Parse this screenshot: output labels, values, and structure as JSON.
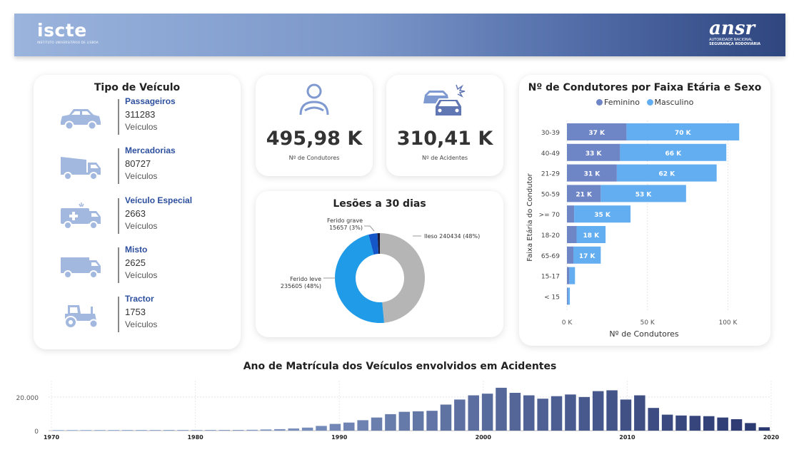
{
  "header": {
    "left_logo": "iscte",
    "left_logo_sub": "INSTITUTO UNIVERSITÁRIO DE LISBOA",
    "right_logo": "ansr",
    "right_logo_sub1": "AUTORIDADE NACIONAL",
    "right_logo_sub2": "SEGURANÇA RODOVIÁRIA"
  },
  "vehicles": {
    "title": "Tipo de Veículo",
    "items": [
      {
        "name": "Passageiros",
        "count": "311283",
        "unit": "Veículos",
        "icon": "car-icon"
      },
      {
        "name": "Mercadorias",
        "count": "80727",
        "unit": "Veículos",
        "icon": "dump-truck-icon"
      },
      {
        "name": "Veículo Especial",
        "count": "2663",
        "unit": "Veículos",
        "icon": "ambulance-icon"
      },
      {
        "name": "Misto",
        "count": "2625",
        "unit": "Veículos",
        "icon": "van-icon"
      },
      {
        "name": "Tractor",
        "count": "1753",
        "unit": "Veículos",
        "icon": "tractor-icon"
      }
    ]
  },
  "kpis": {
    "drivers": {
      "value": "495,98 K",
      "label": "Nº de Condutores",
      "icon": "driver-icon"
    },
    "accidents": {
      "value": "310,41 K",
      "label": "Nº de Acidentes",
      "icon": "car-crash-icon"
    }
  },
  "colors": {
    "feminino": "#6f86c6",
    "masculino": "#63aef0",
    "ileso": "#b5b5b5",
    "ferido_leve": "#1f9be8",
    "ferido_grave": "#1557c9",
    "morto": "#1b1b3a"
  },
  "chart_data": [
    {
      "type": "pie",
      "title": "Lesões a 30 dias",
      "donut": true,
      "slices": [
        {
          "label": "Ileso",
          "value": 240434,
          "percent_label": "240434 (48%)"
        },
        {
          "label": "Ferido leve",
          "value": 235605,
          "percent_label": "235605 (48%)"
        },
        {
          "label": "Ferido grave",
          "value": 15657,
          "percent_label": "15657 (3%)"
        },
        {
          "label": "",
          "value": 4300,
          "percent_label": ""
        }
      ],
      "annotations": {
        "ileso": "Ileso 240434 (48%)",
        "leve_1": "Ferido leve",
        "leve_2": "235605 (48%)",
        "grave_1": "Ferido grave",
        "grave_2": "15657 (3%)"
      }
    },
    {
      "type": "bar",
      "orientation": "horizontal",
      "stacked": true,
      "title": "Nº de Condutores por Faixa Etária e Sexo",
      "xlabel": "Nº de Condutores",
      "ylabel": "Faixa Etária do Condutor",
      "legend_position": "top",
      "categories": [
        "30-39",
        "40-49",
        "21-29",
        "50-59",
        ">= 70",
        "18-20",
        "65-69",
        "15-17",
        "< 15"
      ],
      "series": [
        {
          "name": "Feminino",
          "values": [
            37000,
            33000,
            31000,
            21000,
            4500,
            6000,
            4000,
            1500,
            600
          ],
          "labels": [
            "37 K",
            "33 K",
            "31 K",
            "21 K",
            "",
            "",
            "",
            "",
            ""
          ]
        },
        {
          "name": "Masculino",
          "values": [
            70000,
            66000,
            62000,
            53000,
            35000,
            18000,
            17000,
            3500,
            1200
          ],
          "labels": [
            "70 K",
            "66 K",
            "62 K",
            "53 K",
            "35 K",
            "18 K",
            "17 K",
            "",
            ""
          ]
        }
      ],
      "xlim": [
        0,
        110000
      ],
      "xticks": [
        "0 K",
        "50 K",
        "100 K"
      ],
      "xtick_values": [
        0,
        50000,
        100000
      ]
    },
    {
      "type": "bar",
      "title": "Ano de Matrícula dos Veículos envolvidos em Acidentes",
      "xlabel": "",
      "ylabel": "",
      "years": [
        1970,
        1971,
        1972,
        1973,
        1974,
        1975,
        1976,
        1977,
        1978,
        1979,
        1980,
        1981,
        1982,
        1983,
        1984,
        1985,
        1986,
        1987,
        1988,
        1989,
        1990,
        1991,
        1992,
        1993,
        1994,
        1995,
        1996,
        1997,
        1998,
        1999,
        2000,
        2001,
        2002,
        2003,
        2004,
        2005,
        2006,
        2007,
        2008,
        2009,
        2010,
        2011,
        2012,
        2013,
        2014,
        2015,
        2016,
        2017,
        2018,
        2019
      ],
      "values": [
        200,
        200,
        200,
        200,
        200,
        200,
        200,
        200,
        200,
        200,
        200,
        300,
        300,
        400,
        500,
        700,
        900,
        1300,
        1800,
        2800,
        4000,
        4800,
        6200,
        7800,
        9800,
        11200,
        11500,
        11800,
        15500,
        18500,
        21000,
        22000,
        25500,
        22500,
        21000,
        19000,
        20500,
        21500,
        20000,
        23500,
        24000,
        18500,
        21000,
        13500,
        9500,
        9000,
        8800,
        8600,
        7800,
        6800,
        4500,
        2000
      ],
      "ylim": [
        0,
        28000
      ],
      "yticks": [
        "0",
        "20.000"
      ],
      "ytick_values": [
        0,
        20000
      ],
      "xticks": [
        "1970",
        "1980",
        "1990",
        "2000",
        "2010",
        "2020"
      ],
      "xtick_values": [
        1970,
        1980,
        1990,
        2000,
        2010,
        2020
      ],
      "grid": true
    }
  ]
}
